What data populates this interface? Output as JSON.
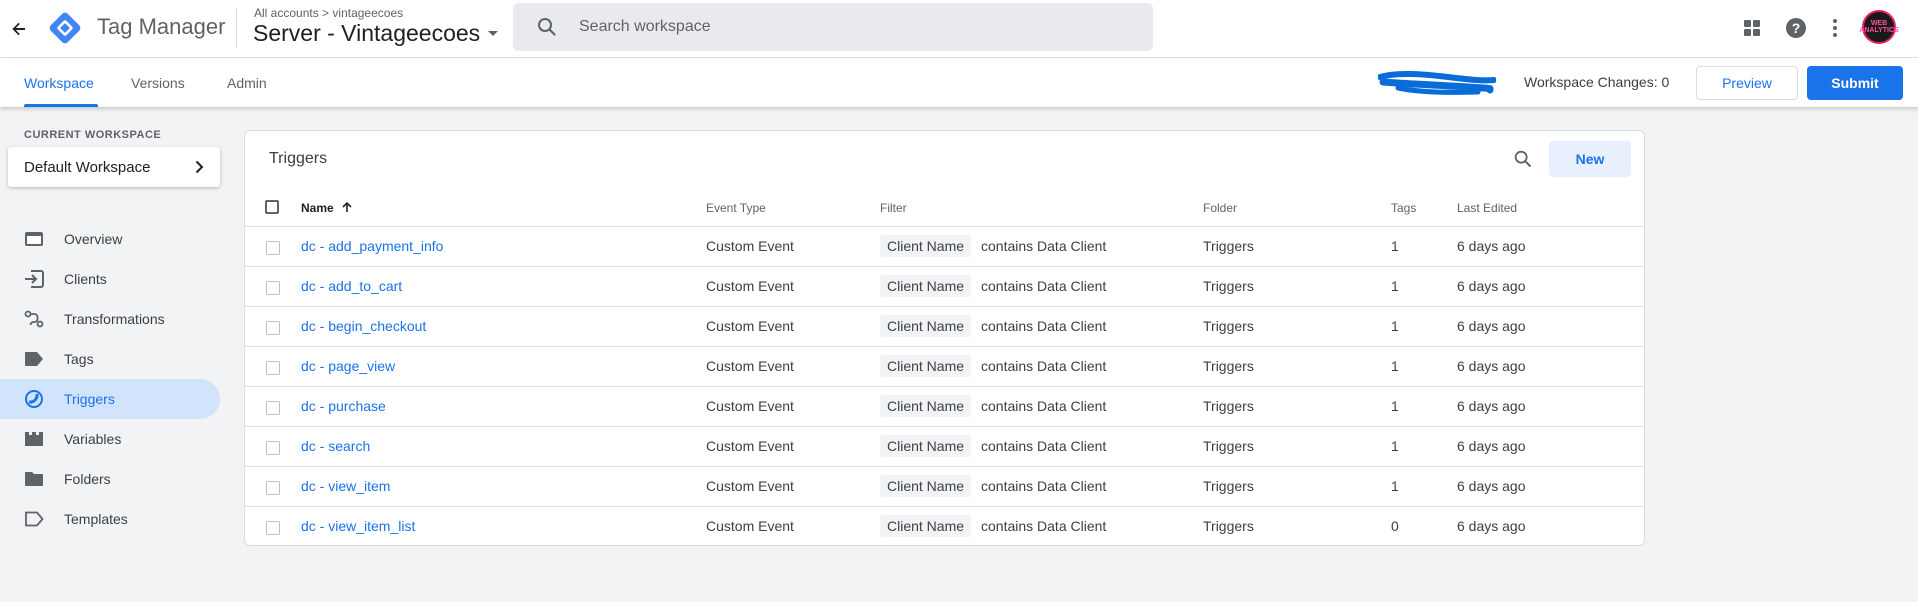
{
  "header": {
    "product_name": "Tag Manager",
    "breadcrumb": {
      "all_accounts": "All accounts",
      "separator": ">",
      "account": "vintageecoes"
    },
    "container_name": "Server - Vintageecoes",
    "search_placeholder": "Search workspace",
    "avatar_text": "WEB ANALYTICS"
  },
  "nav": {
    "tabs": [
      {
        "label": "Workspace"
      },
      {
        "label": "Versions"
      },
      {
        "label": "Admin"
      }
    ],
    "workspace_changes": "Workspace Changes: 0",
    "preview_label": "Preview",
    "submit_label": "Submit"
  },
  "sidebar": {
    "current_workspace_label": "CURRENT WORKSPACE",
    "workspace_name": "Default Workspace",
    "items": [
      {
        "label": "Overview",
        "icon": "overview-icon"
      },
      {
        "label": "Clients",
        "icon": "clients-icon"
      },
      {
        "label": "Transformations",
        "icon": "transformations-icon"
      },
      {
        "label": "Tags",
        "icon": "tag-icon"
      },
      {
        "label": "Triggers",
        "icon": "trigger-icon",
        "active": true
      },
      {
        "label": "Variables",
        "icon": "variables-icon"
      },
      {
        "label": "Folders",
        "icon": "folder-icon"
      },
      {
        "label": "Templates",
        "icon": "template-icon"
      }
    ]
  },
  "triggers": {
    "title": "Triggers",
    "new_label": "New",
    "columns": {
      "name": "Name",
      "event_type": "Event Type",
      "filter": "Filter",
      "folder": "Folder",
      "tags": "Tags",
      "last_edited": "Last Edited"
    },
    "rows": [
      {
        "name": "dc - add_payment_info",
        "event_type": "Custom Event",
        "filter_var": "Client Name",
        "filter_cond": "contains Data Client",
        "folder": "Triggers",
        "tags": "1",
        "last_edited": "6 days ago"
      },
      {
        "name": "dc - add_to_cart",
        "event_type": "Custom Event",
        "filter_var": "Client Name",
        "filter_cond": "contains Data Client",
        "folder": "Triggers",
        "tags": "1",
        "last_edited": "6 days ago"
      },
      {
        "name": "dc - begin_checkout",
        "event_type": "Custom Event",
        "filter_var": "Client Name",
        "filter_cond": "contains Data Client",
        "folder": "Triggers",
        "tags": "1",
        "last_edited": "6 days ago"
      },
      {
        "name": "dc - page_view",
        "event_type": "Custom Event",
        "filter_var": "Client Name",
        "filter_cond": "contains Data Client",
        "folder": "Triggers",
        "tags": "1",
        "last_edited": "6 days ago"
      },
      {
        "name": "dc - purchase",
        "event_type": "Custom Event",
        "filter_var": "Client Name",
        "filter_cond": "contains Data Client",
        "folder": "Triggers",
        "tags": "1",
        "last_edited": "6 days ago"
      },
      {
        "name": "dc - search",
        "event_type": "Custom Event",
        "filter_var": "Client Name",
        "filter_cond": "contains Data Client",
        "folder": "Triggers",
        "tags": "1",
        "last_edited": "6 days ago"
      },
      {
        "name": "dc - view_item",
        "event_type": "Custom Event",
        "filter_var": "Client Name",
        "filter_cond": "contains Data Client",
        "folder": "Triggers",
        "tags": "1",
        "last_edited": "6 days ago"
      },
      {
        "name": "dc - view_item_list",
        "event_type": "Custom Event",
        "filter_var": "Client Name",
        "filter_cond": "contains Data Client",
        "folder": "Triggers",
        "tags": "0",
        "last_edited": "6 days ago"
      }
    ]
  },
  "colors": {
    "accent": "#1a73e8",
    "active_bg": "#d2e3fc",
    "background": "#f1f3f4"
  }
}
